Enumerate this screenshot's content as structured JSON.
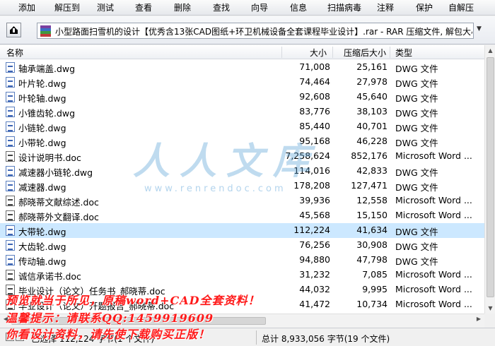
{
  "toolbar": {
    "items": [
      "添加",
      "解压到",
      "测试",
      "查看",
      "删除",
      "查找",
      "向导",
      "信息",
      "扫描病毒",
      "注释",
      "保护",
      "自解压"
    ]
  },
  "address": {
    "up_icon": "up-folder-icon",
    "archive_icon": "rar-archive-icon",
    "path": "小型路面扫雪机的设计【优秀含13张CAD图纸+环卫机械设备全套课程毕业设计】.rar - RAR 压缩文件, 解包大小"
  },
  "columns": {
    "name": "名称",
    "size": "大小",
    "packed": "压缩后大小",
    "type": "类型"
  },
  "files": [
    {
      "name": "轴承端盖.dwg",
      "size": "71,008",
      "packed": "25,161",
      "type": "DWG 文件",
      "kind": "dwg",
      "selected": false
    },
    {
      "name": "叶片轮.dwg",
      "size": "74,464",
      "packed": "27,978",
      "type": "DWG 文件",
      "kind": "dwg",
      "selected": false
    },
    {
      "name": "叶轮轴.dwg",
      "size": "92,608",
      "packed": "45,640",
      "type": "DWG 文件",
      "kind": "dwg",
      "selected": false
    },
    {
      "name": "小锥齿轮.dwg",
      "size": "83,776",
      "packed": "38,103",
      "type": "DWG 文件",
      "kind": "dwg",
      "selected": false
    },
    {
      "name": "小链轮.dwg",
      "size": "85,440",
      "packed": "40,701",
      "type": "DWG 文件",
      "kind": "dwg",
      "selected": false
    },
    {
      "name": "小带轮.dwg",
      "size": "95,168",
      "packed": "46,228",
      "type": "DWG 文件",
      "kind": "dwg",
      "selected": false
    },
    {
      "name": "设计说明书.doc",
      "size": "7,258,624",
      "packed": "852,176",
      "type": "Microsoft Word ...",
      "kind": "doc",
      "selected": false
    },
    {
      "name": "减速器小链轮.dwg",
      "size": "114,016",
      "packed": "42,833",
      "type": "DWG 文件",
      "kind": "dwg",
      "selected": false
    },
    {
      "name": "减速器.dwg",
      "size": "178,208",
      "packed": "127,471",
      "type": "DWG 文件",
      "kind": "dwg",
      "selected": false
    },
    {
      "name": "郝晓蒂文献综述.doc",
      "size": "39,936",
      "packed": "12,558",
      "type": "Microsoft Word ...",
      "kind": "doc",
      "selected": false
    },
    {
      "name": "郝晓蒂外文翻译.doc",
      "size": "45,568",
      "packed": "15,150",
      "type": "Microsoft Word ...",
      "kind": "doc",
      "selected": false
    },
    {
      "name": "大带轮.dwg",
      "size": "112,224",
      "packed": "41,634",
      "type": "DWG 文件",
      "kind": "dwg",
      "selected": true
    },
    {
      "name": "大齿轮.dwg",
      "size": "76,256",
      "packed": "30,908",
      "type": "DWG 文件",
      "kind": "dwg",
      "selected": false
    },
    {
      "name": "传动轴.dwg",
      "size": "94,880",
      "packed": "47,798",
      "type": "DWG 文件",
      "kind": "dwg",
      "selected": false
    },
    {
      "name": "诚信承诺书.doc",
      "size": "31,232",
      "packed": "7,085",
      "type": "Microsoft Word ...",
      "kind": "doc",
      "selected": false
    },
    {
      "name": "毕业设计（论文）任务书_郝晓蒂.doc",
      "size": "44,032",
      "packed": "9,995",
      "type": "Microsoft Word ...",
      "kind": "doc",
      "selected": false
    },
    {
      "name": "毕业设计（论文）开题报告_郝晓蒂.doc",
      "size": "41,472",
      "packed": "10,734",
      "type": "Microsoft Word ...",
      "kind": "doc",
      "selected": false
    }
  ],
  "status": {
    "left": "已选择 112,224 字节(1 个文件)",
    "right": "总计 8,933,056 字节(19 个文件)"
  },
  "watermark": {
    "logo": "人人文库",
    "url": "www.renrendoc.com"
  },
  "promo": {
    "line1": "预览就当于所见，原稿word+CAD全套资料！",
    "line2": "温馨提示：请联系QQ:1459919609",
    "line3": "你看设计资料，请先使下载购买正版！"
  },
  "colors": {
    "selected_row": "#cce8ff",
    "promo_text": "#ff1a1a",
    "watermark": "#56a0d6"
  }
}
